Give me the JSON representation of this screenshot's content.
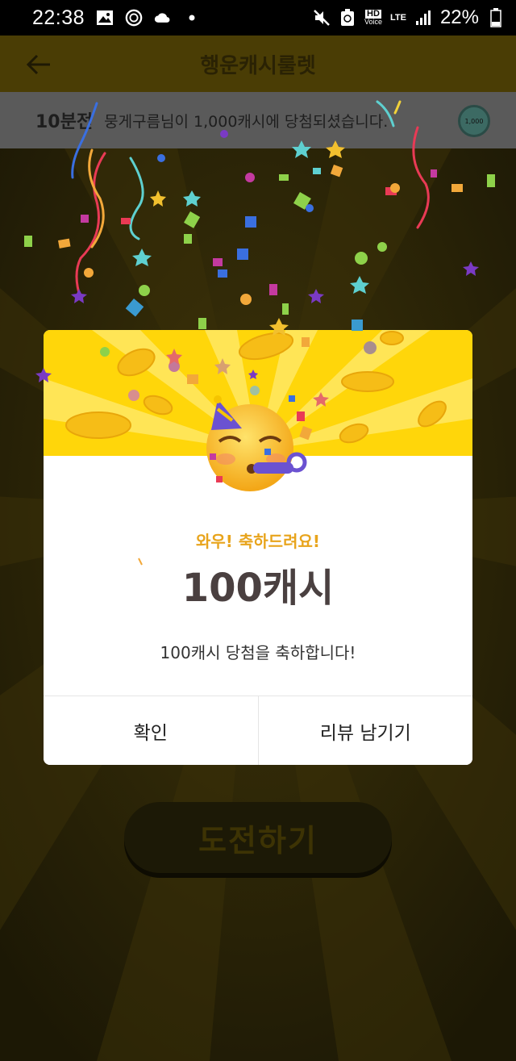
{
  "status_bar": {
    "time": "22:38",
    "hd_label": "HD",
    "voice_label": "Voice",
    "network": "LTE",
    "battery": "22%"
  },
  "app_bar": {
    "title": "행운캐시룰렛"
  },
  "ticker": {
    "when": "10분전",
    "message": "뭉게구름님이 1,000캐시에 당첨되셨습니다.",
    "coin_label": "1,000"
  },
  "challenge_button": "도전하기",
  "dialog": {
    "congrats": "와우! 축하드려요!",
    "amount": "100캐시",
    "message": "100캐시 당첨을 축하합니다!",
    "confirm_label": "확인",
    "review_label": "리뷰 남기기"
  },
  "colors": {
    "accent_yellow": "#ffd60a",
    "congrats_orange": "#e8a41c"
  }
}
